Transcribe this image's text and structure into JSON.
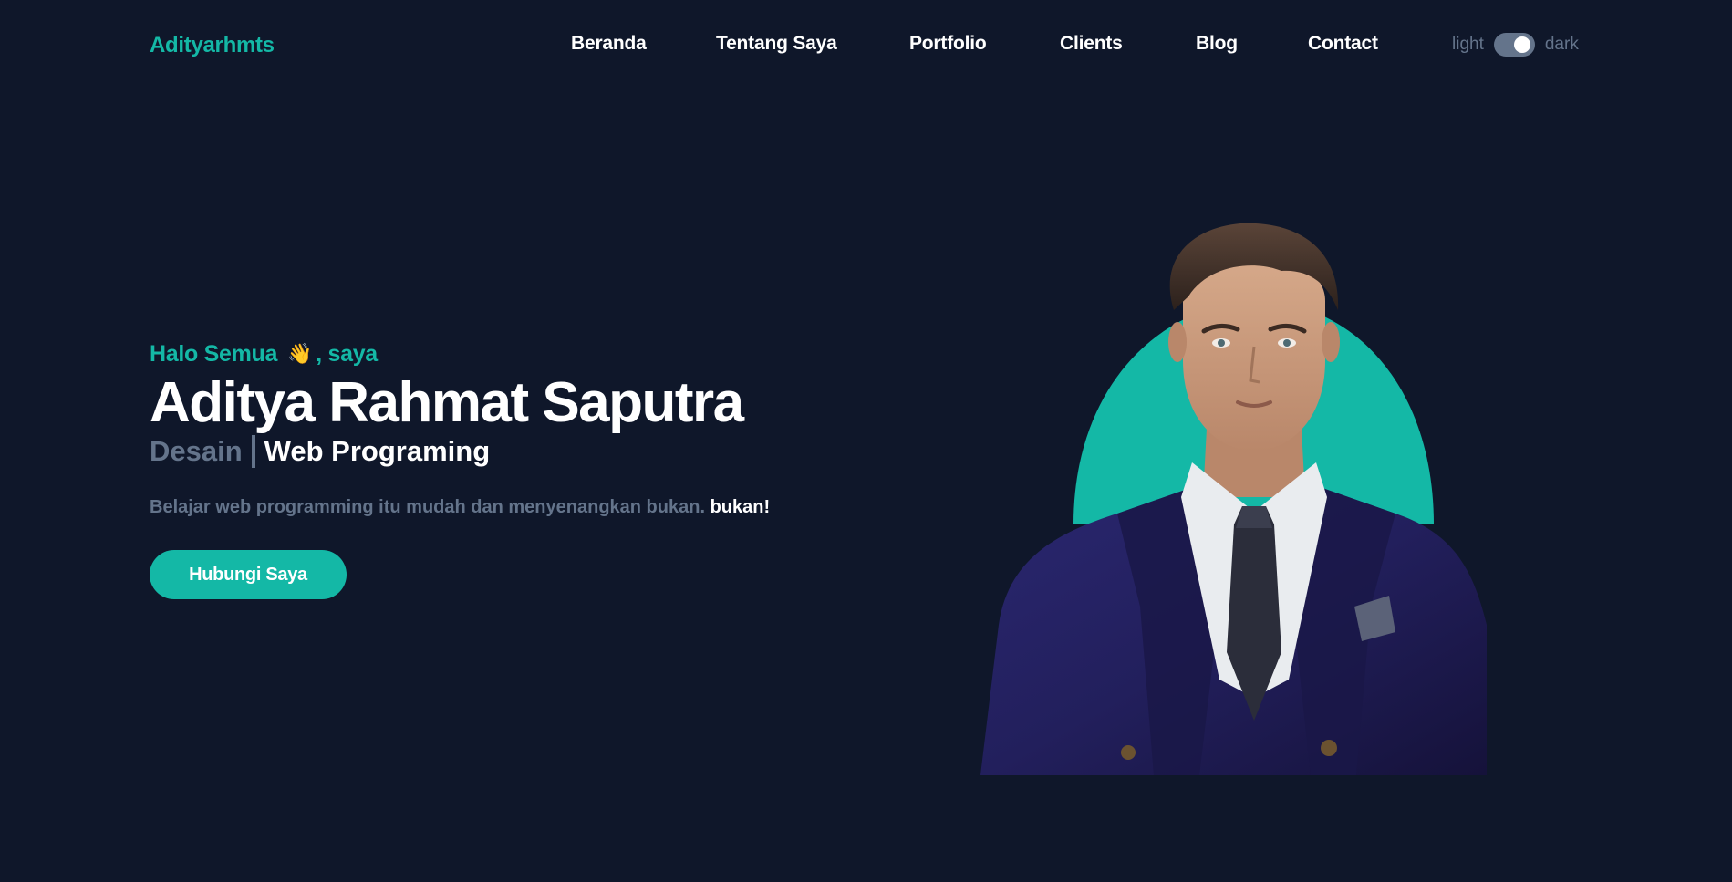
{
  "nav": {
    "brand": "Adityarhmts",
    "items": [
      {
        "label": "Beranda"
      },
      {
        "label": "Tentang Saya"
      },
      {
        "label": "Portfolio"
      },
      {
        "label": "Clients"
      },
      {
        "label": "Blog"
      },
      {
        "label": "Contact"
      }
    ],
    "theme_toggle": {
      "light_label": "light",
      "dark_label": "dark",
      "state": "dark"
    }
  },
  "hero": {
    "greeting_prefix": "Halo Semua",
    "greeting_emoji": "👋",
    "greeting_suffix": ", saya",
    "name": "Aditya Rahmat Saputra",
    "role_primary": "Desain",
    "role_secondary": "Web Programing",
    "tagline": "Belajar web programming itu mudah dan menyenangkan bukan.",
    "tagline_emphasis": "bukan!",
    "cta_label": "Hubungi Saya"
  },
  "colors": {
    "background": "#0f172a",
    "accent": "#14b8a6",
    "muted": "#64748b",
    "text": "#ffffff"
  }
}
